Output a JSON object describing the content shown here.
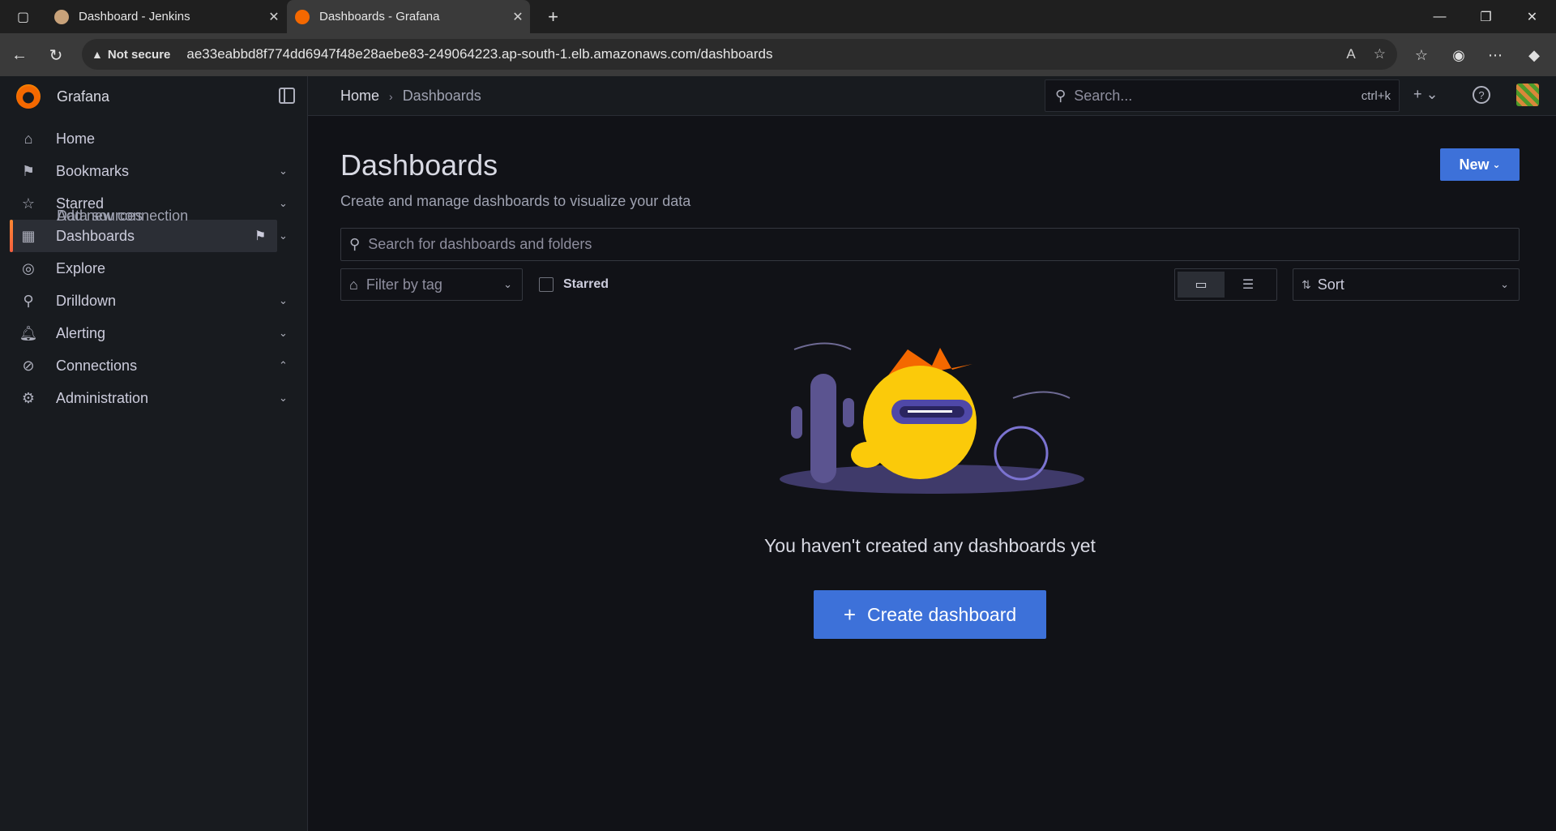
{
  "browser": {
    "tabs": [
      {
        "title": "Dashboard - Jenkins"
      },
      {
        "title": "Dashboards - Grafana"
      }
    ],
    "address": {
      "security_label": "Not secure",
      "url": "ae33eabbd8f774dd6947f48e28aebe83-249064223.ap-south-1.elb.amazonaws.com/dashboards"
    }
  },
  "grafana": {
    "brand": "Grafana",
    "breadcrumb": {
      "home": "Home",
      "current": "Dashboards"
    },
    "search": {
      "placeholder": "Search...",
      "shortcut": "ctrl+k"
    },
    "nav": {
      "items": [
        {
          "label": "Home"
        },
        {
          "label": "Bookmarks"
        },
        {
          "label": "Starred"
        },
        {
          "label": "Dashboards"
        },
        {
          "label": "Explore"
        },
        {
          "label": "Drilldown"
        },
        {
          "label": "Alerting"
        },
        {
          "label": "Connections"
        },
        {
          "label": "Add new connection"
        },
        {
          "label": "Data sources"
        },
        {
          "label": "Administration"
        }
      ]
    },
    "page": {
      "title": "Dashboards",
      "subtitle": "Create and manage dashboards to visualize your data",
      "new_label": "New",
      "search_placeholder": "Search for dashboards and folders",
      "filter_tag_label": "Filter by tag",
      "starred_label": "Starred",
      "sort_label": "Sort",
      "empty_message": "You haven't created any dashboards yet",
      "create_label": "Create dashboard"
    },
    "colors": {
      "primary": "#3d71d9",
      "accent": "#f46800",
      "background": "#111217"
    }
  }
}
